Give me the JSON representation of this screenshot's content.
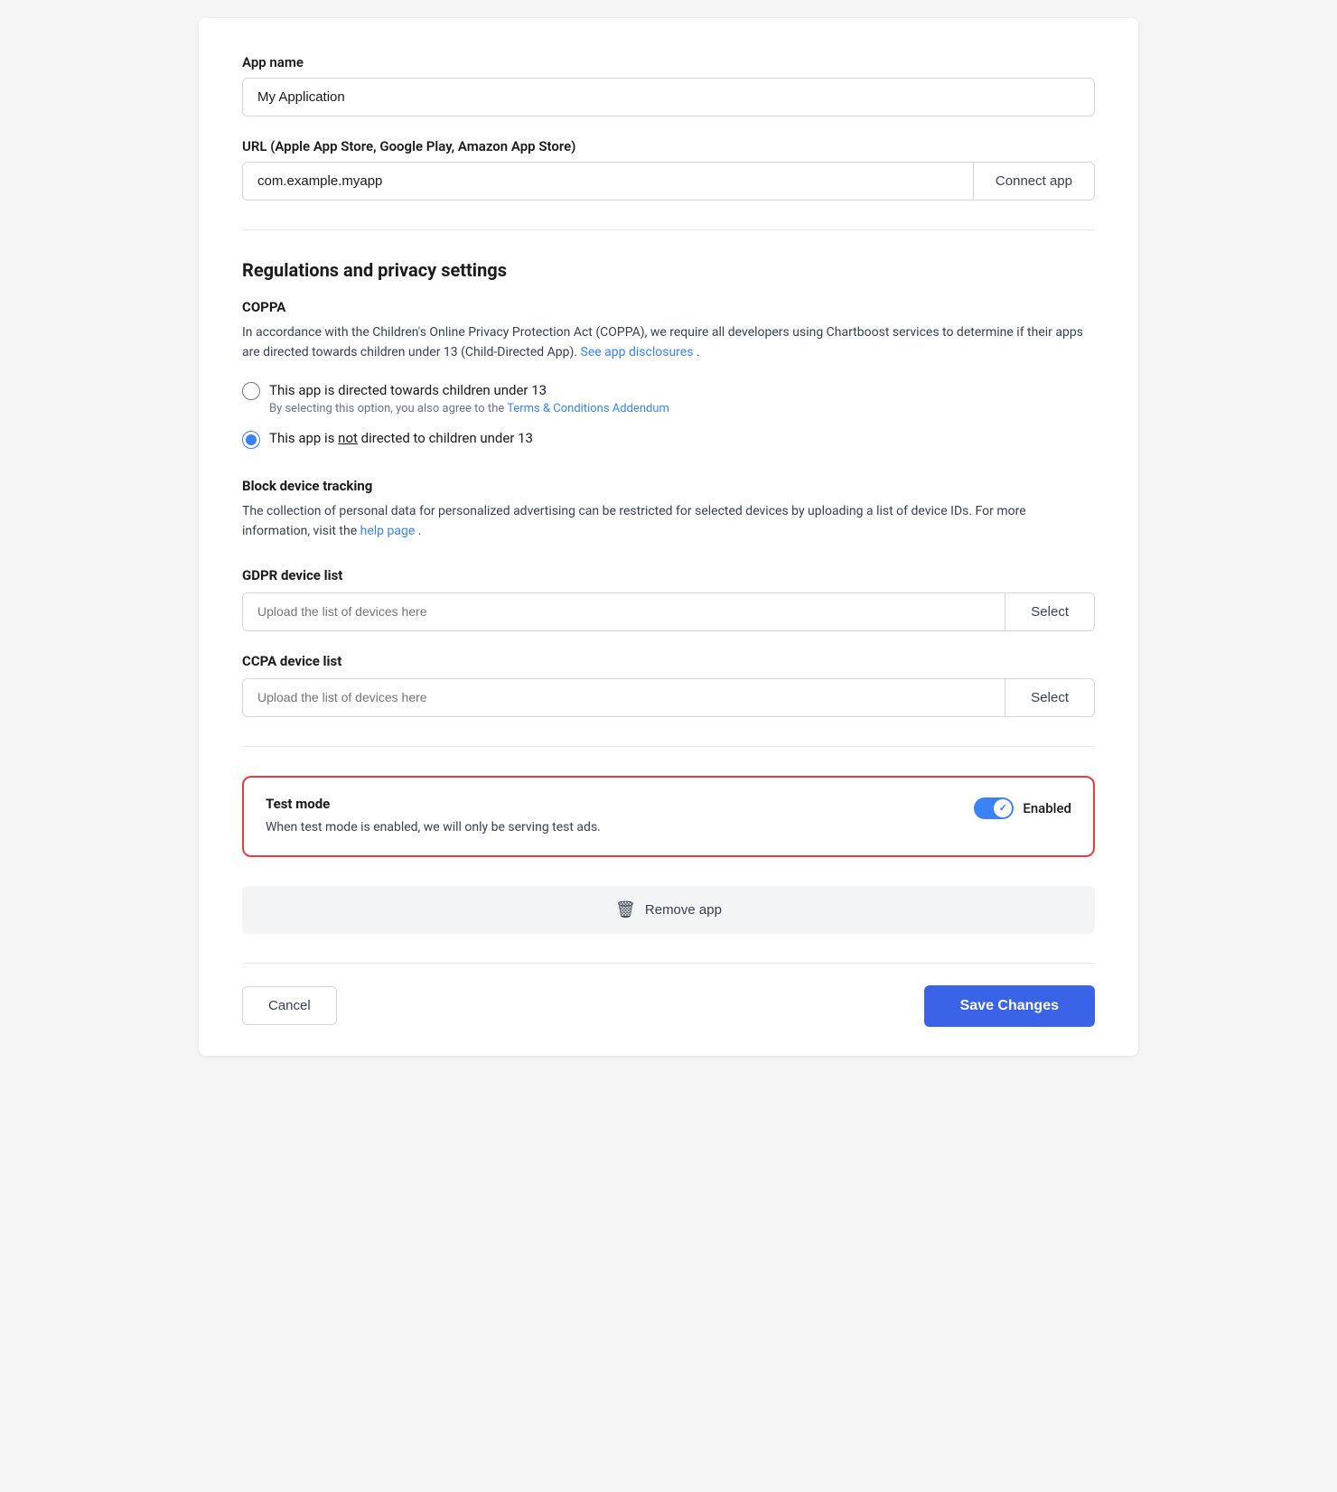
{
  "app_name": {
    "label": "App name",
    "value": "My Application",
    "placeholder": "My Application"
  },
  "url": {
    "label": "URL (Apple App Store, Google Play, Amazon App Store)",
    "value": "com.example.myapp",
    "placeholder": "com.example.myapp",
    "button_label": "Connect app"
  },
  "regulations": {
    "section_title": "Regulations and privacy settings",
    "coppa": {
      "title": "COPPA",
      "description_part1": "In accordance with the Children's Online Privacy Protection Act (COPPA), we require all developers using Chartboost services to determine if their apps are directed towards children under 13 (Child-Directed App). ",
      "description_link": "See app disclosures",
      "description_end": ".",
      "radio_option1_label": "This app is directed towards children under 13",
      "radio_option1_sublabel_part1": "By selecting this option, you also agree to the ",
      "radio_option1_sublabel_link": "Terms & Conditions Addendum",
      "radio_option2_label_pre": "This app is ",
      "radio_option2_label_underline": "not",
      "radio_option2_label_post": " directed to children under 13"
    },
    "block_tracking": {
      "title": "Block device tracking",
      "description_part1": "The collection of personal data for personalized advertising can be restricted for selected devices by uploading a list of device IDs. For more information, visit the ",
      "description_link": "help page",
      "description_end": "."
    },
    "gdpr": {
      "label": "GDPR device list",
      "placeholder": "Upload the list of devices here",
      "button_label": "Select"
    },
    "ccpa": {
      "label": "CCPA device list",
      "placeholder": "Upload the list of devices here",
      "button_label": "Select"
    }
  },
  "test_mode": {
    "title": "Test mode",
    "description": "When test mode is enabled, we will only be serving test ads.",
    "toggle_label": "Enabled",
    "enabled": true
  },
  "remove_app": {
    "label": "Remove app"
  },
  "footer": {
    "cancel_label": "Cancel",
    "save_label": "Save Changes"
  }
}
